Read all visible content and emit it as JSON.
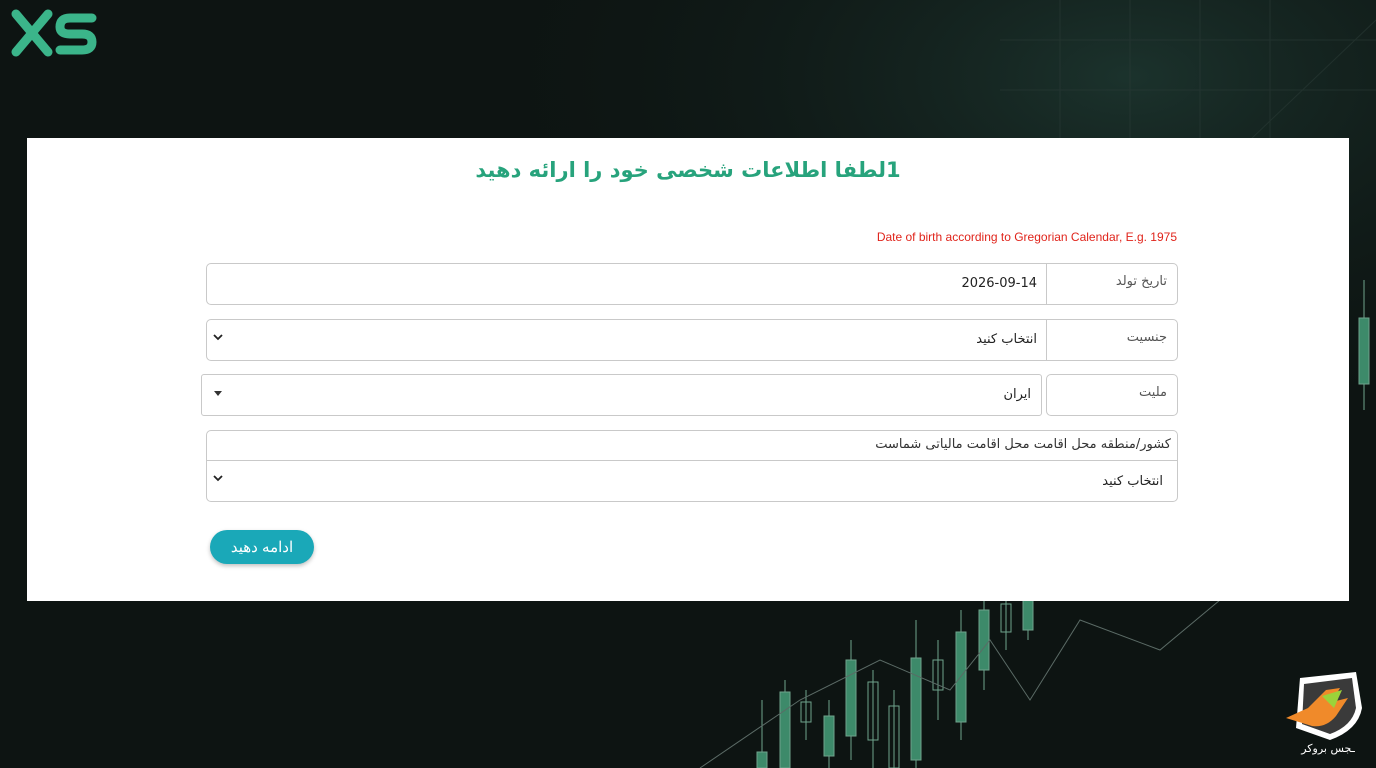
{
  "brand": {
    "logo_text": "XS",
    "watermark_text": "ـجس بروکر"
  },
  "form": {
    "title": "1لطفا اطلاعات شخصی خود را ارائه دهید",
    "dob_note": "Date of birth according to Gregorian Calendar, E.g. 1975",
    "birthdate": {
      "label": "تاریخ تولد",
      "value": "2026-09-14"
    },
    "gender": {
      "label": "جنسیت",
      "selected": "انتخاب کنید"
    },
    "nationality": {
      "label": "ملیت",
      "selected": "ایران"
    },
    "tax_residence": {
      "label": "کشور/منطقه محل اقامت محل اقامت مالیاتی شماست",
      "selected": "انتخاب کنید"
    },
    "continue_label": "ادامه دهید"
  },
  "colors": {
    "accent_green": "#27a37c",
    "button_teal": "#1aa8b8",
    "error_red": "#e0241b",
    "background": "#0d1412"
  }
}
